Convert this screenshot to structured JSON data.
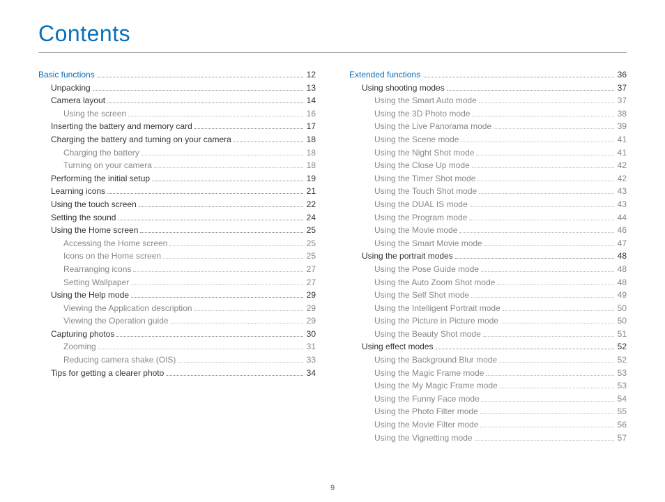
{
  "title": "Contents",
  "page_number": "9",
  "columns": [
    [
      {
        "level": 0,
        "section": true,
        "label": "Basic functions",
        "page": "12"
      },
      {
        "level": 1,
        "section": false,
        "label": "Unpacking",
        "page": "13"
      },
      {
        "level": 1,
        "section": false,
        "label": "Camera layout",
        "page": "14"
      },
      {
        "level": 2,
        "section": false,
        "label": "Using the screen",
        "page": "16"
      },
      {
        "level": 1,
        "section": false,
        "label": "Inserting the battery and memory card",
        "page": "17"
      },
      {
        "level": 1,
        "section": false,
        "label": "Charging the battery and turning on your camera",
        "page": "18"
      },
      {
        "level": 2,
        "section": false,
        "label": "Charging the battery",
        "page": "18"
      },
      {
        "level": 2,
        "section": false,
        "label": "Turning on your camera",
        "page": "18"
      },
      {
        "level": 1,
        "section": false,
        "label": "Performing the initial setup",
        "page": "19"
      },
      {
        "level": 1,
        "section": false,
        "label": "Learning icons",
        "page": "21"
      },
      {
        "level": 1,
        "section": false,
        "label": "Using the touch screen",
        "page": "22"
      },
      {
        "level": 1,
        "section": false,
        "label": "Setting the sound",
        "page": "24"
      },
      {
        "level": 1,
        "section": false,
        "label": "Using the Home screen",
        "page": "25"
      },
      {
        "level": 2,
        "section": false,
        "label": "Accessing the Home screen",
        "page": "25"
      },
      {
        "level": 2,
        "section": false,
        "label": "Icons on the Home screen",
        "page": "25"
      },
      {
        "level": 2,
        "section": false,
        "label": "Rearranging icons",
        "page": "27"
      },
      {
        "level": 2,
        "section": false,
        "label": "Setting Wallpaper",
        "page": "27"
      },
      {
        "level": 1,
        "section": false,
        "label": "Using the Help mode",
        "page": "29"
      },
      {
        "level": 2,
        "section": false,
        "label": "Viewing the Application description",
        "page": "29"
      },
      {
        "level": 2,
        "section": false,
        "label": "Viewing the Operation guide",
        "page": "29"
      },
      {
        "level": 1,
        "section": false,
        "label": "Capturing photos",
        "page": "30"
      },
      {
        "level": 2,
        "section": false,
        "label": "Zooming",
        "page": "31"
      },
      {
        "level": 2,
        "section": false,
        "label": "Reducing camera shake (OIS)",
        "page": "33"
      },
      {
        "level": 1,
        "section": false,
        "label": "Tips for getting a clearer photo",
        "page": "34"
      }
    ],
    [
      {
        "level": 0,
        "section": true,
        "label": "Extended functions",
        "page": "36"
      },
      {
        "level": 1,
        "section": false,
        "label": "Using shooting modes",
        "page": "37"
      },
      {
        "level": 2,
        "section": false,
        "label": "Using the Smart Auto mode",
        "page": "37"
      },
      {
        "level": 2,
        "section": false,
        "label": "Using the 3D Photo mode",
        "page": "38"
      },
      {
        "level": 2,
        "section": false,
        "label": "Using the Live Panorama mode",
        "page": "39"
      },
      {
        "level": 2,
        "section": false,
        "label": "Using the Scene mode",
        "page": "41"
      },
      {
        "level": 2,
        "section": false,
        "label": "Using the Night Shot mode",
        "page": "41"
      },
      {
        "level": 2,
        "section": false,
        "label": "Using the Close Up mode",
        "page": "42"
      },
      {
        "level": 2,
        "section": false,
        "label": "Using the Timer Shot mode",
        "page": "42"
      },
      {
        "level": 2,
        "section": false,
        "label": "Using the Touch Shot mode",
        "page": "43"
      },
      {
        "level": 2,
        "section": false,
        "label": "Using the DUAL IS mode",
        "page": "43"
      },
      {
        "level": 2,
        "section": false,
        "label": "Using the Program mode",
        "page": "44"
      },
      {
        "level": 2,
        "section": false,
        "label": "Using the Movie mode",
        "page": "46"
      },
      {
        "level": 2,
        "section": false,
        "label": "Using the Smart Movie mode",
        "page": "47"
      },
      {
        "level": 1,
        "section": false,
        "label": "Using the portrait modes",
        "page": "48"
      },
      {
        "level": 2,
        "section": false,
        "label": "Using the Pose Guide mode",
        "page": "48"
      },
      {
        "level": 2,
        "section": false,
        "label": "Using the Auto Zoom Shot mode",
        "page": "48"
      },
      {
        "level": 2,
        "section": false,
        "label": "Using the Self Shot mode",
        "page": "49"
      },
      {
        "level": 2,
        "section": false,
        "label": "Using the Intelligent Portrait mode",
        "page": "50"
      },
      {
        "level": 2,
        "section": false,
        "label": "Using the Picture in Picture mode",
        "page": "50"
      },
      {
        "level": 2,
        "section": false,
        "label": "Using the Beauty Shot mode",
        "page": "51"
      },
      {
        "level": 1,
        "section": false,
        "label": "Using effect modes",
        "page": "52"
      },
      {
        "level": 2,
        "section": false,
        "label": "Using the Background Blur mode",
        "page": "52"
      },
      {
        "level": 2,
        "section": false,
        "label": "Using the Magic Frame mode",
        "page": "53"
      },
      {
        "level": 2,
        "section": false,
        "label": "Using the My Magic Frame mode",
        "page": "53"
      },
      {
        "level": 2,
        "section": false,
        "label": "Using the Funny Face mode",
        "page": "54"
      },
      {
        "level": 2,
        "section": false,
        "label": "Using the Photo Filter mode",
        "page": "55"
      },
      {
        "level": 2,
        "section": false,
        "label": "Using the Movie Filter mode",
        "page": "56"
      },
      {
        "level": 2,
        "section": false,
        "label": "Using the Vignetting mode",
        "page": "57"
      }
    ]
  ]
}
